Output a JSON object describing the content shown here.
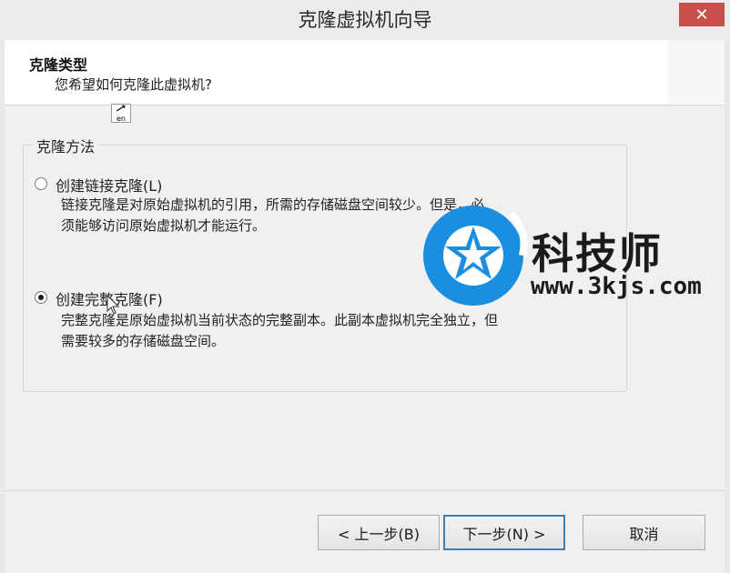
{
  "window": {
    "title": "克隆虚拟机向导",
    "close_glyph": "✕"
  },
  "header": {
    "title": "克隆类型",
    "subtitle": "您希望如何克隆此虚拟机?"
  },
  "ime_indicator": {
    "label": "en"
  },
  "clone_method": {
    "group_title": "克隆方法",
    "options": [
      {
        "label": "创建链接克隆(L)",
        "selected": false,
        "desc_line1": "链接克隆是对原始虚拟机的引用，所需的存储磁盘空间较少。但是，必",
        "desc_line2": "须能够访问原始虚拟机才能运行。"
      },
      {
        "label": "创建完整克隆(F)",
        "selected": true,
        "desc_line1": "完整克隆是原始虚拟机当前状态的完整副本。此副本虚拟机完全独立，但",
        "desc_line2": "需要较多的存储磁盘空间。"
      }
    ]
  },
  "buttons": {
    "back": "< 上一步(B)",
    "next": "下一步(N) >",
    "cancel": "取消"
  },
  "watermark": {
    "name": "科技师",
    "url": "www.3kjs.com",
    "icon": "star-logo-icon",
    "color": "#1a8fe0"
  }
}
